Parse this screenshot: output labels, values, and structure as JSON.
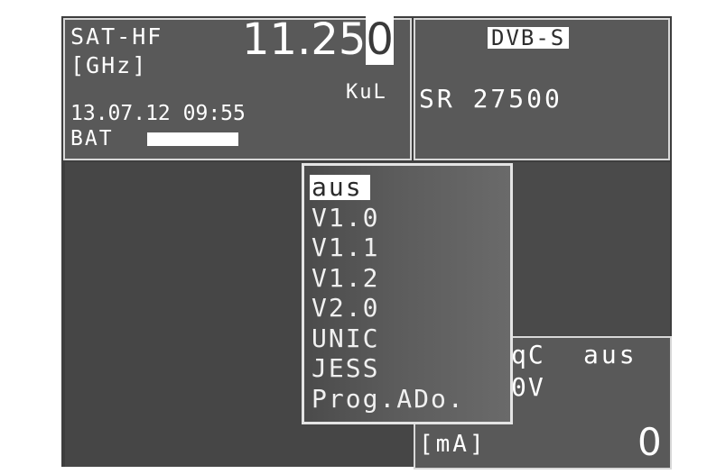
{
  "sat_panel": {
    "label": "SAT-HF",
    "unit": "[GHz]",
    "frequency_main": "11.25",
    "frequency_cursor_digit": "0",
    "band": "KuL",
    "datetime": "13.07.12 09:55",
    "battery_label": "BAT",
    "battery_level_percent": 100
  },
  "signal_panel": {
    "standard": "DVB-S",
    "symbol_rate": "SR 27500"
  },
  "diseqc_menu": {
    "items": [
      {
        "label": "aus",
        "selected": true
      },
      {
        "label": "V1.0",
        "selected": false
      },
      {
        "label": "V1.1",
        "selected": false
      },
      {
        "label": "V1.2",
        "selected": false
      },
      {
        "label": "V2.0",
        "selected": false
      },
      {
        "label": "UNIC",
        "selected": false
      },
      {
        "label": "JESS",
        "selected": false
      },
      {
        "label": "Prog.ADo.",
        "selected": false
      }
    ]
  },
  "lnb_panel": {
    "diseqc_label_partial": "qC",
    "diseqc_value": "aus",
    "voltage_partial": "0V",
    "current_unit": "[mA]",
    "current_value": "0"
  }
}
